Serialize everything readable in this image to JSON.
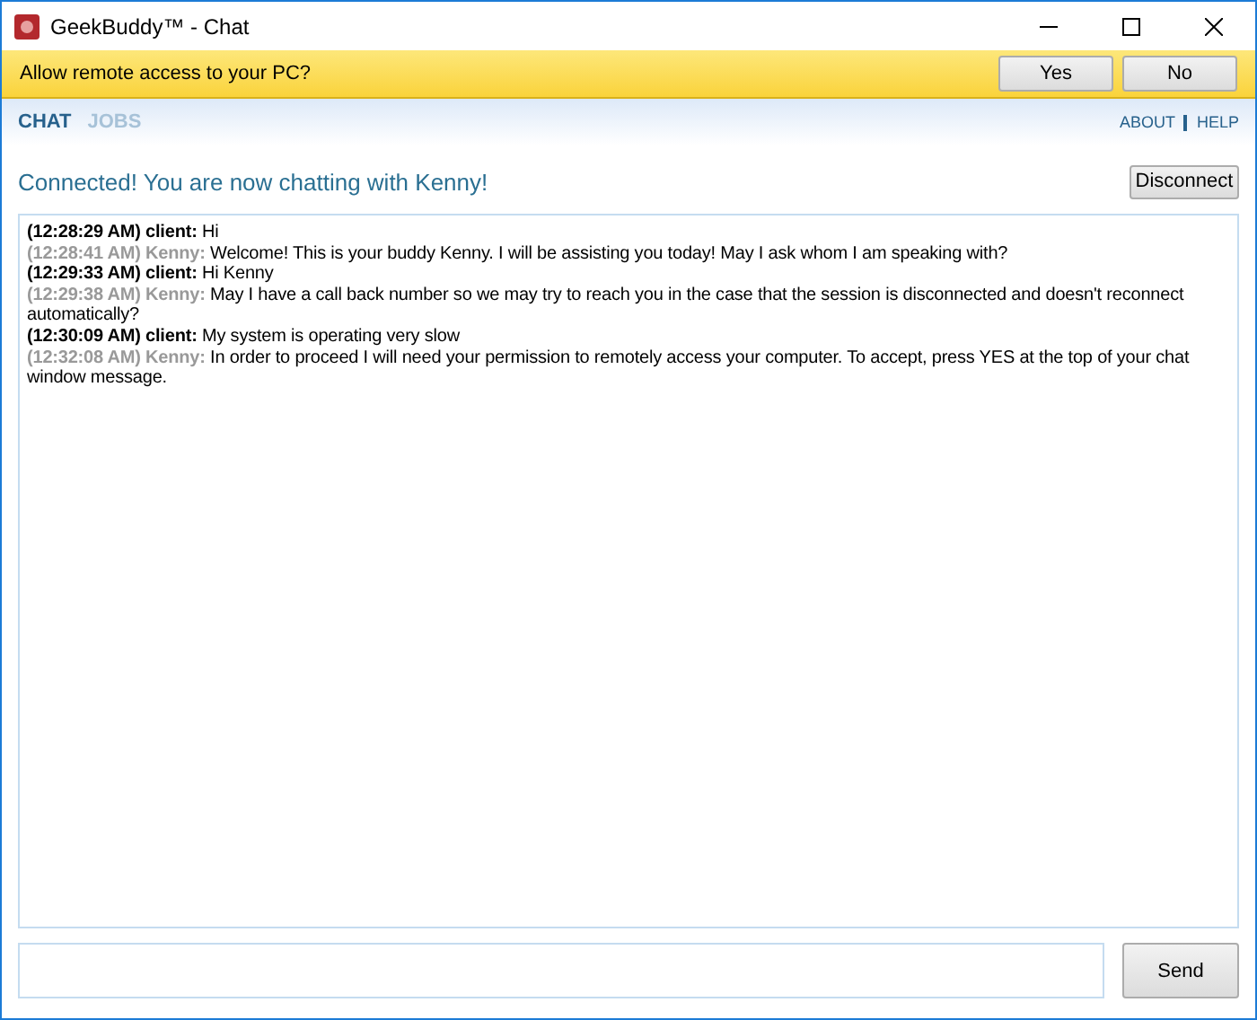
{
  "window": {
    "title": "GeekBuddy™ - Chat"
  },
  "prompt": {
    "text": "Allow remote access to your PC?",
    "buttons": [
      "Yes",
      "No"
    ]
  },
  "tabs": [
    {
      "label": "CHAT",
      "selected": true
    },
    {
      "label": "JOBS",
      "selected": false
    }
  ],
  "links": [
    "ABOUT",
    "HELP"
  ],
  "status": "Connected! You are now chatting with Kenny!",
  "disconnect_button": "Disconnect",
  "messages": [
    {
      "kind": "client",
      "time": "(12:28:29 AM)",
      "sender": "client:",
      "text": "Hi"
    },
    {
      "kind": "agent",
      "time": "(12:28:41 AM)",
      "sender": "Kenny:",
      "text": "Welcome! This is your buddy Kenny. I will be assisting you today! May I ask whom I am speaking with?"
    },
    {
      "kind": "client",
      "time": "(12:29:33 AM)",
      "sender": "client:",
      "text": "Hi Kenny"
    },
    {
      "kind": "agent",
      "time": "(12:29:38 AM)",
      "sender": "Kenny:",
      "text": "May I have a call back number so we may try to reach you in the case that the session is disconnected and doesn't reconnect automatically?"
    },
    {
      "kind": "client",
      "time": "(12:30:09 AM)",
      "sender": "client:",
      "text": "My system is operating very slow"
    },
    {
      "kind": "agent",
      "time": "(12:32:08 AM)",
      "sender": "Kenny:",
      "text": "In order to proceed I will need your permission to remotely access your computer. To accept, press YES at the top of your chat window message."
    }
  ],
  "send_button": "Send"
}
